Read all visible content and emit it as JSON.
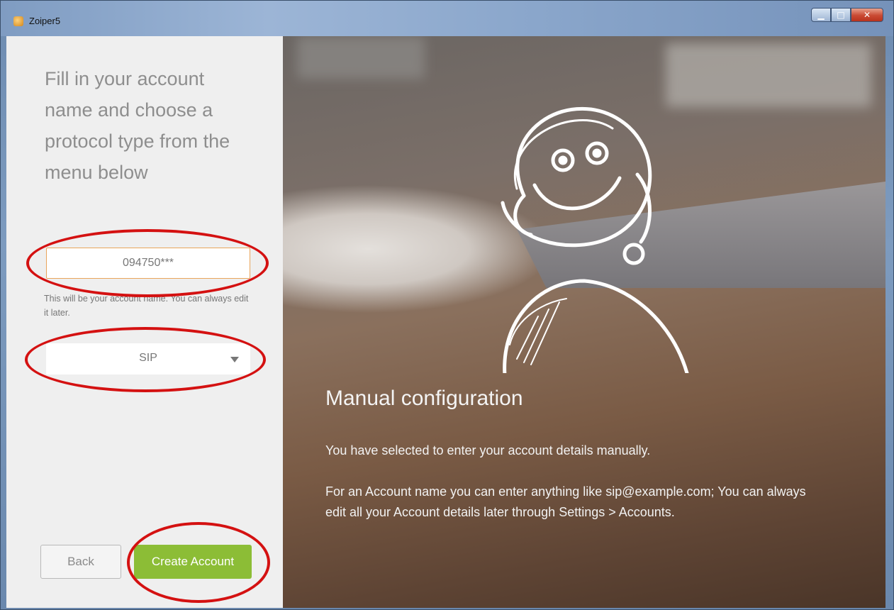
{
  "window": {
    "title": "Zoiper5",
    "controls": {
      "minimize": "▁",
      "maximize": "□",
      "close": "✕"
    }
  },
  "left_pane": {
    "heading": "Fill in your account name and choose a protocol type from the menu below",
    "account_name_value": "094750***",
    "account_hint": "This will be your account name. You can always edit it later.",
    "protocol_selected": "SIP",
    "back_label": "Back",
    "create_label": "Create Account"
  },
  "right_pane": {
    "title": "Manual configuration",
    "paragraph1": "You have selected to enter your account details manually.",
    "paragraph2": "For an Account name you can enter anything like sip@example.com; You can always edit all your Account details later through Settings > Accounts."
  },
  "colors": {
    "accent_green": "#8cbd36",
    "input_border": "#e9a55b",
    "annotation_red": "#d41111"
  },
  "icons": {
    "app": "zoiper-app-icon",
    "dropdown": "chevron-down-icon",
    "illustration": "headset-mascot-icon"
  }
}
